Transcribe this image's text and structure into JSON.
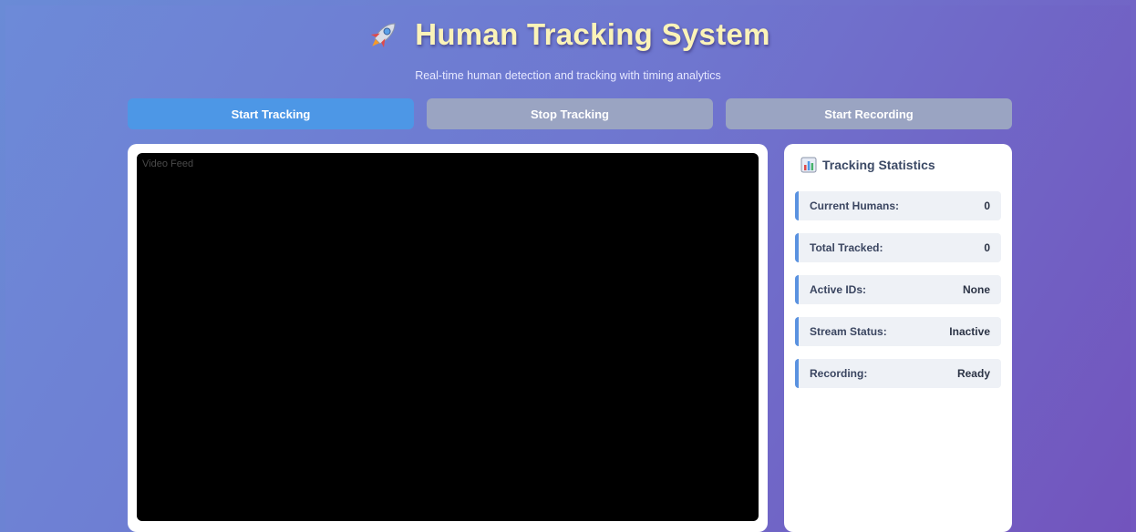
{
  "header": {
    "title": "Human Tracking System",
    "subtitle": "Real-time human detection and tracking with timing analytics",
    "title_icon": "rocket-icon"
  },
  "controls": {
    "start_tracking": "Start Tracking",
    "stop_tracking": "Stop Tracking",
    "start_recording": "Start Recording"
  },
  "video": {
    "label": "Video Feed"
  },
  "stats": {
    "heading": "Tracking Statistics",
    "heading_icon": "bar-chart-icon",
    "rows": [
      {
        "label": "Current Humans:",
        "value": "0"
      },
      {
        "label": "Total Tracked:",
        "value": "0"
      },
      {
        "label": "Active IDs:",
        "value": "None"
      },
      {
        "label": "Stream Status:",
        "value": "Inactive"
      },
      {
        "label": "Recording:",
        "value": "Ready"
      }
    ]
  },
  "colors": {
    "primary_button": "#4d97e6",
    "disabled_button": "#9aa4c2",
    "title": "#fbf3b8",
    "background_start": "#6a8bd6",
    "background_end": "#7358c0"
  }
}
